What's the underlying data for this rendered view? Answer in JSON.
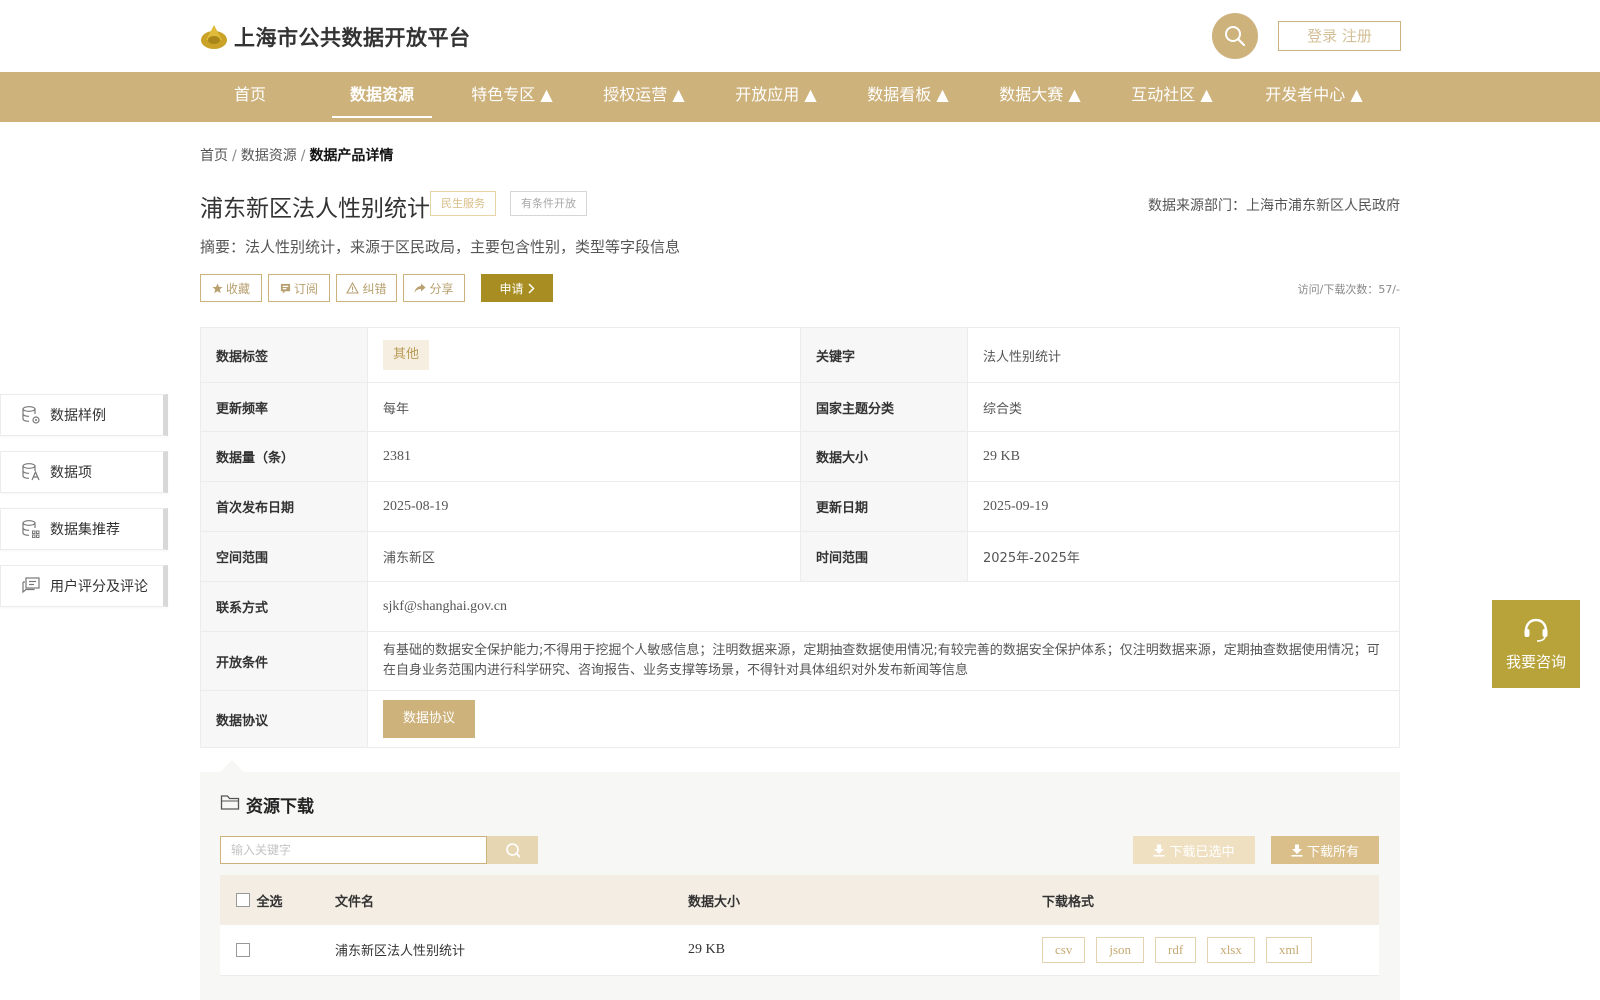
{
  "header": {
    "site_title": "上海市公共数据开放平台",
    "login_label": "登录 注册",
    "accent_color": "#cdb27c"
  },
  "nav": {
    "items": [
      {
        "label": "首页"
      },
      {
        "label": "数据资源"
      },
      {
        "label": "特色专区 ▲"
      },
      {
        "label": "授权运营 ▲"
      },
      {
        "label": "开放应用 ▲"
      },
      {
        "label": "数据看板 ▲"
      },
      {
        "label": "数据大赛 ▲"
      },
      {
        "label": "互动社区 ▲"
      },
      {
        "label": "开发者中心 ▲"
      }
    ],
    "active_index": 1
  },
  "breadcrumb": {
    "home": "首页",
    "sep": "/",
    "resources": "数据资源",
    "current": "数据产品详情"
  },
  "product": {
    "title": "浦东新区法人性别统计",
    "badge_service": "民生服务",
    "badge_open": "有条件开放",
    "source_dept": "数据来源部门：上海市浦东新区人民政府",
    "summary": "摘要：法人性别统计，来源于区民政局，主要包含性别，类型等字段信息"
  },
  "actions": {
    "favorite": "收藏",
    "subscribe": "订阅",
    "report": "纠错",
    "share": "分享",
    "apply": "申请",
    "visit_count": "访问/下载次数：57/-"
  },
  "info": {
    "tag_label": "数据标签",
    "tag_value": "其他",
    "keyword_label": "关键字",
    "keyword_value": "法人性别统计",
    "freq_label": "更新频率",
    "freq_value": "每年",
    "theme_label": "国家主题分类",
    "theme_value": "综合类",
    "count_label": "数据量（条）",
    "count_value": "2381",
    "size_label": "数据大小",
    "size_value": "29 KB",
    "first_date_label": "首次发布日期",
    "first_date_value": "2025-08-19",
    "update_date_label": "更新日期",
    "update_date_value": "2025-09-19",
    "space_label": "空间范围",
    "space_value": "浦东新区",
    "time_label": "时间范围",
    "time_value": "2025年-2025年",
    "contact_label": "联系方式",
    "contact_value": "sjkf@shanghai.gov.cn",
    "condition_label": "开放条件",
    "condition_value": "有基础的数据安全保护能力;不得用于挖掘个人敏感信息；注明数据来源，定期抽查数据使用情况;有较完善的数据安全保护体系；仅注明数据来源，定期抽查数据使用情况；可在自身业务范围内进行科学研究、咨询报告、业务支撑等场景，不得针对具体组织对外发布新闻等信息",
    "protocol_label": "数据协议",
    "protocol_button": "数据协议"
  },
  "sidebar": {
    "items": [
      {
        "label": "数据样例",
        "icon": "database-gear-icon"
      },
      {
        "label": "数据项",
        "icon": "database-text-icon"
      },
      {
        "label": "数据集推荐",
        "icon": "database-grid-icon"
      },
      {
        "label": "用户评分及评论",
        "icon": "comment-icon"
      }
    ]
  },
  "consult": {
    "label": "我要咨询",
    "color": "#b8a23a"
  },
  "download": {
    "title": "资源下载",
    "search_placeholder": "输入关键字",
    "download_selected": "下载已选中",
    "download_all": "下载所有",
    "columns": {
      "select_all": "全选",
      "filename": "文件名",
      "size": "数据大小",
      "format": "下载格式"
    },
    "rows": [
      {
        "filename": "浦东新区法人性别统计",
        "size": "29 KB",
        "formats": [
          "csv",
          "json",
          "rdf",
          "xlsx",
          "xml"
        ]
      }
    ]
  }
}
